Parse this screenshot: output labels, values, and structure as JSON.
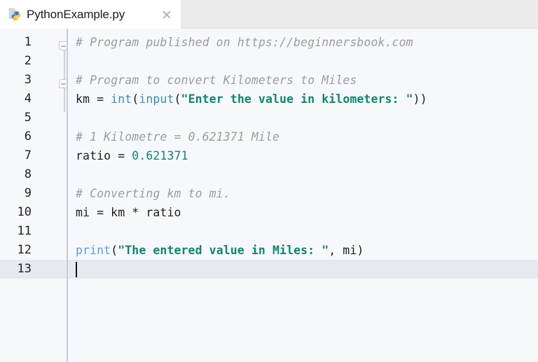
{
  "tab": {
    "filename": "PythonExample.py",
    "icon": "python-file-icon",
    "close_icon": "close-icon",
    "active": true
  },
  "editor": {
    "language": "python",
    "current_line": 13,
    "cursor": {
      "line": 13,
      "column": 1
    },
    "colors": {
      "background": "#f7f8fc",
      "gutter_separator": "#c9cad6",
      "current_line_highlight": "#e8e9ee",
      "comment": "#9b9ba0",
      "string": "#13836f",
      "number": "#12836f",
      "builtin": "#3f8ca8",
      "print_keyword": "#5c9fd1",
      "plain_text": "#1c1c1c",
      "tabbar_background": "#ebebeb",
      "active_tab_background": "#ffffff"
    },
    "line_numbers": [
      "1",
      "2",
      "3",
      "4",
      "5",
      "6",
      "7",
      "8",
      "9",
      "10",
      "11",
      "12",
      "13"
    ],
    "lines": [
      {
        "n": 1,
        "text": "# Program published on https://beginnersbook.com"
      },
      {
        "n": 2,
        "text": ""
      },
      {
        "n": 3,
        "text": "# Program to convert Kilometers to Miles"
      },
      {
        "n": 4,
        "text": "km = int(input(\"Enter the value in kilometers: \"))"
      },
      {
        "n": 5,
        "text": ""
      },
      {
        "n": 6,
        "text": "# 1 Kilometre = 0.621371 Mile"
      },
      {
        "n": 7,
        "text": "ratio = 0.621371"
      },
      {
        "n": 8,
        "text": ""
      },
      {
        "n": 9,
        "text": "# Converting km to mi."
      },
      {
        "n": 10,
        "text": "mi = km * ratio"
      },
      {
        "n": 11,
        "text": ""
      },
      {
        "n": 12,
        "text": "print(\"The entered value in Miles: \", mi)"
      },
      {
        "n": 13,
        "text": ""
      }
    ],
    "tokens": {
      "l1_comment": "# Program published on https://beginnersbook.com",
      "l3_comment": "# Program to convert Kilometers to Miles",
      "l4_var": "km = ",
      "l4_int": "int",
      "l4_p1": "(",
      "l4_input": "input",
      "l4_p2": "(",
      "l4_str": "\"Enter the value in kilometers: \"",
      "l4_p3": "))",
      "l6_comment": "# 1 Kilometre = 0.621371 Mile",
      "l7_var": "ratio = ",
      "l7_num": "0.621371",
      "l9_comment": "# Converting km to mi.",
      "l10_expr": "mi = km * ratio",
      "l12_print": "print",
      "l12_p1": "(",
      "l12_str": "\"The entered value in Miles: \"",
      "l12_tail": ", mi)"
    },
    "fold_markers": [
      {
        "line": 1,
        "state": "expanded",
        "icon": "fold-collapse-icon"
      },
      {
        "line": 3,
        "state": "expanded",
        "icon": "fold-collapse-icon"
      }
    ]
  }
}
